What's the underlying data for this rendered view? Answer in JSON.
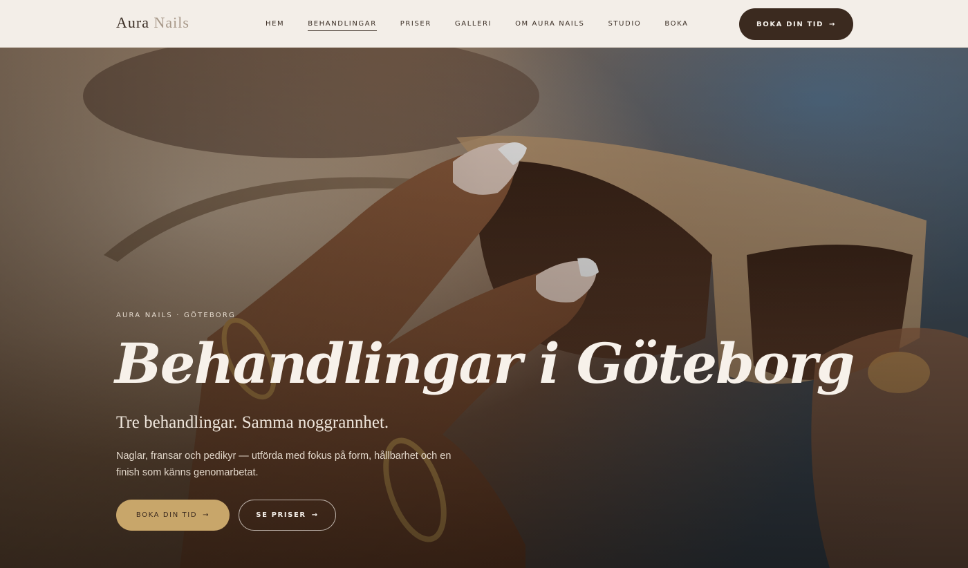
{
  "header": {
    "logo_main": "Aura",
    "logo_accent": "Nails",
    "nav": [
      "HEM",
      "BEHANDLINGAR",
      "PRISER",
      "GALLERI",
      "OM AURA NAILS",
      "STUDIO",
      "BOKA"
    ],
    "active_nav": "BEHANDLINGAR",
    "cta_label": "BOKA DIN TID",
    "cta_arrow": "→"
  },
  "hero": {
    "eyebrow": "AURA NAILS · GÖTEBORG",
    "title": "Behandlingar i Göteborg",
    "subtitle": "Tre behandlingar. Samma noggrannhet.",
    "description": "Naglar, fransar och pedikyr — utförda med fokus på form, hållbarhet och en finish som känns genomarbetat.",
    "primary_button": "BOKA DIN TID",
    "secondary_button": "SE PRISER",
    "arrow": "→"
  },
  "colors": {
    "header_bg": "#f3eee8",
    "dark_brown": "#3b2a1f",
    "gold": "#c8a66a",
    "cream_text": "#f7f1ea"
  }
}
